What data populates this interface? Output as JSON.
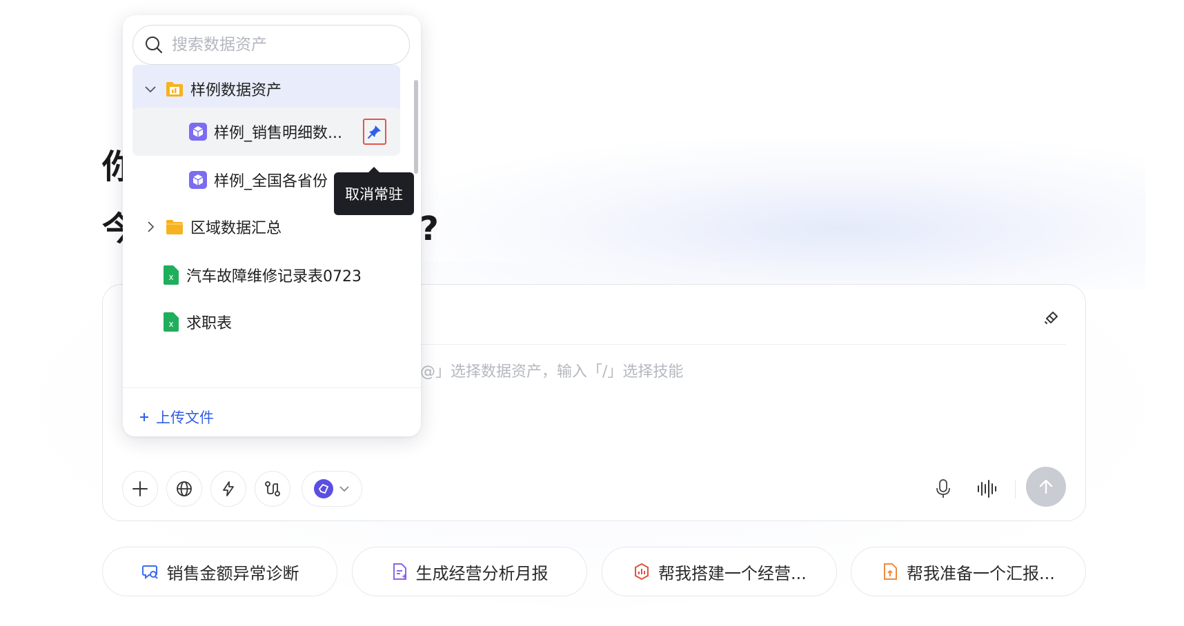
{
  "greeting": {
    "line1": "你",
    "line2": "今",
    "suffix": "?"
  },
  "dropdown": {
    "search_placeholder": "搜索数据资产",
    "folder_sample": "样例数据资产",
    "item_sales": "样例_销售明细数...",
    "item_province": "样例_全国各省份",
    "folder_region": "区域数据汇总",
    "file_car": "汽车故障维修记录表0723",
    "file_job": "求职表",
    "upload": "上传文件"
  },
  "tooltip": {
    "text": "取消常驻"
  },
  "composer": {
    "placeholder": "@」选择数据资产，输入「/」选择技能"
  },
  "chips": [
    {
      "label": "销售金额异常诊断",
      "icon": "chat-search-icon",
      "color": "#3b6cf0"
    },
    {
      "label": "生成经营分析月报",
      "icon": "doc-sparkle-icon",
      "color": "#8a63e8"
    },
    {
      "label": "帮我搭建一个经营...",
      "icon": "dashboard-icon",
      "color": "#e0513c"
    },
    {
      "label": "帮我准备一个汇报...",
      "icon": "doc-upload-icon",
      "color": "#f08a3c"
    }
  ],
  "colors": {
    "accent": "#2f5ee8",
    "highlight": "#e5534b",
    "selected_row": "#e8ecfb"
  }
}
